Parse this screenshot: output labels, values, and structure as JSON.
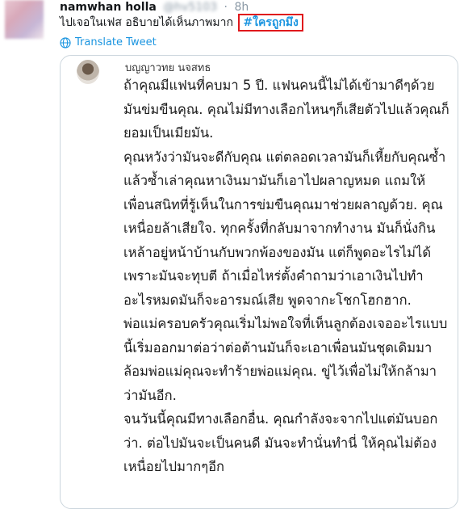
{
  "tweet": {
    "user_name": "namwhan holla",
    "user_handle": "@hv5103",
    "separator": "·",
    "time": "8h",
    "text": "ไปเจอในเฟส อธิบายได้เห็นภาพมาก",
    "hashtag": "#ใครถูกมึง",
    "translate_label": "Translate Tweet"
  },
  "media": {
    "author_name": "บญญาวทย นจสทธ",
    "paragraphs": [
      "ถ้าคุณมีแฟนที่คบมา 5 ปี. แฟนคนนี้ไม่ได้เข้ามาดีๆด้วยมันข่มขืนคุณ. คุณไม่มีทางเลือกไหนๆก็เสียตัวไปแล้วคุณก็ยอมเป็นเมียมัน.",
      "คุณหวังว่ามันจะดีกับคุณ แต่ตลอดเวลามันก็เหี้ยกับคุณซ้ำแล้วซ้ำเล่าคุณหาเงินมามันก็เอาไปผลาญหมด แถมให้เพื่อนสนิทที่รู้เห็นในการข่มขืนคุณมาช่วยผลาญด้วย. คุณเหนื่อยล้าเสียใจ. ทุกครั้งที่กลับมาจากทำงาน มันก็นั่งกินเหล้าอยู่หน้าบ้านกับพวกพ้องของมัน แต่ก็พูดอะไรไม่ได้เพราะมันจะทุบตี ถ้าเมื่อไหร่ตั้งคำถามว่าเอาเงินไปทำอะไรหมดมันก็จะอารมณ์เสีย พูดจากะโชกโฮกฮาก.",
      "พ่อแม่ครอบครัวคุณเริ่มไม่พอใจที่เห็นลูกต้องเจออะไรแบบนี้เริ่มออกมาต่อว่าต่อต้านมันก็จะเอาเพื่อนมันชุดเดิมมาล้อมพ่อแม่คุณจะทำร้ายพ่อแม่คุณ. ขู่ไว้เพื่อไม่ให้กล้ามาว่ามันอีก.",
      "จนวันนี้คุณมีทางเลือกอื่น. คุณกำลังจะจากไปแต่มันบอกว่า. ต่อไปมันจะเป็นคนดี มันจะทำนั่นทำนี่ ให้คุณไม่ต้องเหนื่อยไปมากๆอีก"
    ]
  },
  "colors": {
    "link": "#1b95e0",
    "highlight_border": "#e0181c",
    "muted": "#8a98a5"
  },
  "icons": {
    "translate": "globe-icon"
  }
}
